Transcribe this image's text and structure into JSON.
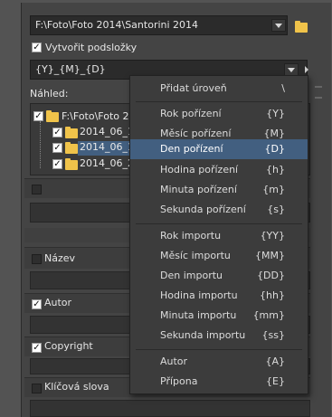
{
  "path_field": {
    "value": "F:\\Foto\\Foto 2014\\Santorini 2014"
  },
  "create_subfolders": {
    "label": "Vytvořit podsložky",
    "checked": true
  },
  "pattern_field": {
    "value": "{Y}_{M}_{D}"
  },
  "preview": {
    "label": "Náhled:"
  },
  "tree": {
    "root": "F:\\Foto\\Foto 2",
    "items": [
      "2014_06_1",
      "2014_06_1",
      "2014_06_2"
    ]
  },
  "options": {
    "name_label": "Název",
    "author_label": "Autor",
    "copyright_label": "Copyright",
    "keywords_label": "Klíčová slova",
    "name_checked": false,
    "author_checked": true,
    "copyright_checked": true,
    "keywords_checked": false
  },
  "menu": {
    "items": [
      {
        "label": "Přidat úroveň",
        "shortcut": "\\"
      },
      {
        "label": "Rok pořízení",
        "shortcut": "{Y}"
      },
      {
        "label": "Měsíc pořízení",
        "shortcut": "{M}"
      },
      {
        "label": "Den pořízení",
        "shortcut": "{D}",
        "highlighted": true
      },
      {
        "label": "Hodina pořízení",
        "shortcut": "{h}"
      },
      {
        "label": "Minuta pořízení",
        "shortcut": "{m}"
      },
      {
        "label": "Sekunda pořízení",
        "shortcut": "{s}"
      },
      {
        "label": "Rok importu",
        "shortcut": "{YY}"
      },
      {
        "label": "Měsíc importu",
        "shortcut": "{MM}"
      },
      {
        "label": "Den importu",
        "shortcut": "{DD}"
      },
      {
        "label": "Hodina importu",
        "shortcut": "{hh}"
      },
      {
        "label": "Minuta importu",
        "shortcut": "{mm}"
      },
      {
        "label": "Sekunda importu",
        "shortcut": "{ss}"
      },
      {
        "label": "Autor",
        "shortcut": "{A}"
      },
      {
        "label": "Přípona",
        "shortcut": "{E}"
      }
    ]
  },
  "colors": {
    "highlight": "#425f80",
    "folder": "#f0c34a",
    "background": "#4a4a4a"
  }
}
